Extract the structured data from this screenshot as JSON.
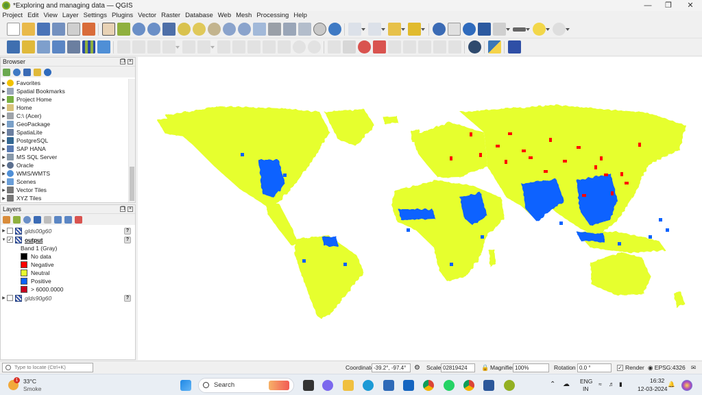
{
  "window": {
    "title": "*Exploring and managing data — QGIS"
  },
  "menu": [
    "Project",
    "Edit",
    "View",
    "Layer",
    "Settings",
    "Plugins",
    "Vector",
    "Raster",
    "Database",
    "Web",
    "Mesh",
    "Processing",
    "Help"
  ],
  "browser": {
    "title": "Browser",
    "items": [
      {
        "label": "Favorites",
        "icon": "star-icon",
        "color": "#f2c200"
      },
      {
        "label": "Spatial Bookmarks",
        "icon": "bookmark-icon",
        "color": "#9aa6b8"
      },
      {
        "label": "Project Home",
        "icon": "project-home-icon",
        "color": "#79b042"
      },
      {
        "label": "Home",
        "icon": "home-folder-icon",
        "color": "#d9c27a"
      },
      {
        "label": "C:\\ (Acer)",
        "icon": "drive-icon",
        "color": "#9fa4aa"
      },
      {
        "label": "GeoPackage",
        "icon": "geopackage-icon",
        "color": "#7aa0c8"
      },
      {
        "label": "SpatiaLite",
        "icon": "spatialite-icon",
        "color": "#6b7fa0"
      },
      {
        "label": "PostgreSQL",
        "icon": "postgresql-icon",
        "color": "#336791"
      },
      {
        "label": "SAP HANA",
        "icon": "sap-hana-icon",
        "color": "#5a7bb3"
      },
      {
        "label": "MS SQL Server",
        "icon": "mssql-icon",
        "color": "#8899aa"
      },
      {
        "label": "Oracle",
        "icon": "oracle-icon",
        "color": "#5b6f8f"
      },
      {
        "label": "WMS/WMTS",
        "icon": "wms-icon",
        "color": "#4f8fd6"
      },
      {
        "label": "Scenes",
        "icon": "scenes-icon",
        "color": "#6a9ed8"
      },
      {
        "label": "Vector Tiles",
        "icon": "vector-tiles-icon",
        "color": "#777777"
      },
      {
        "label": "XYZ Tiles",
        "icon": "xyz-tiles-icon",
        "color": "#777777"
      }
    ]
  },
  "layers": {
    "title": "Layers",
    "items": [
      {
        "name": "glds00g60",
        "checked": false
      },
      {
        "name": "output",
        "checked": true,
        "active": true
      },
      {
        "name": "glds90g60",
        "checked": false
      }
    ],
    "band_label": "Band 1 (Gray)",
    "legend": [
      {
        "label": "No data",
        "color": "#000000"
      },
      {
        "label": "Negative",
        "color": "#ff0000"
      },
      {
        "label": "Neutral",
        "color": "#e6ff2e"
      },
      {
        "label": "Positive",
        "color": "#0a62ff"
      },
      {
        "label": "> 6000.0000",
        "color": "#c8001e"
      }
    ]
  },
  "statusbar": {
    "locate_placeholder": "Type to locate (Ctrl+K)",
    "coordinate_label": "Coordinate",
    "coordinate_value": "-39.2°, -97.4°",
    "scale_label": "Scale",
    "scale_value": "02819424",
    "magnifier_label": "Magnifier",
    "magnifier_value": "100%",
    "rotation_label": "Rotation",
    "rotation_value": "0.0 °",
    "render_label": "Render",
    "crs_label": "EPSG:4326"
  },
  "taskbar": {
    "weather_temp": "33°C",
    "weather_desc": "Smoke",
    "weather_badge": "1",
    "search_label": "Search",
    "lang_primary": "ENG",
    "lang_secondary": "IN",
    "time": "16:32",
    "date": "12-03-2024"
  },
  "colors": {
    "land": "#e6ff2e",
    "positive": "#0a62ff",
    "negative": "#ff0000"
  }
}
